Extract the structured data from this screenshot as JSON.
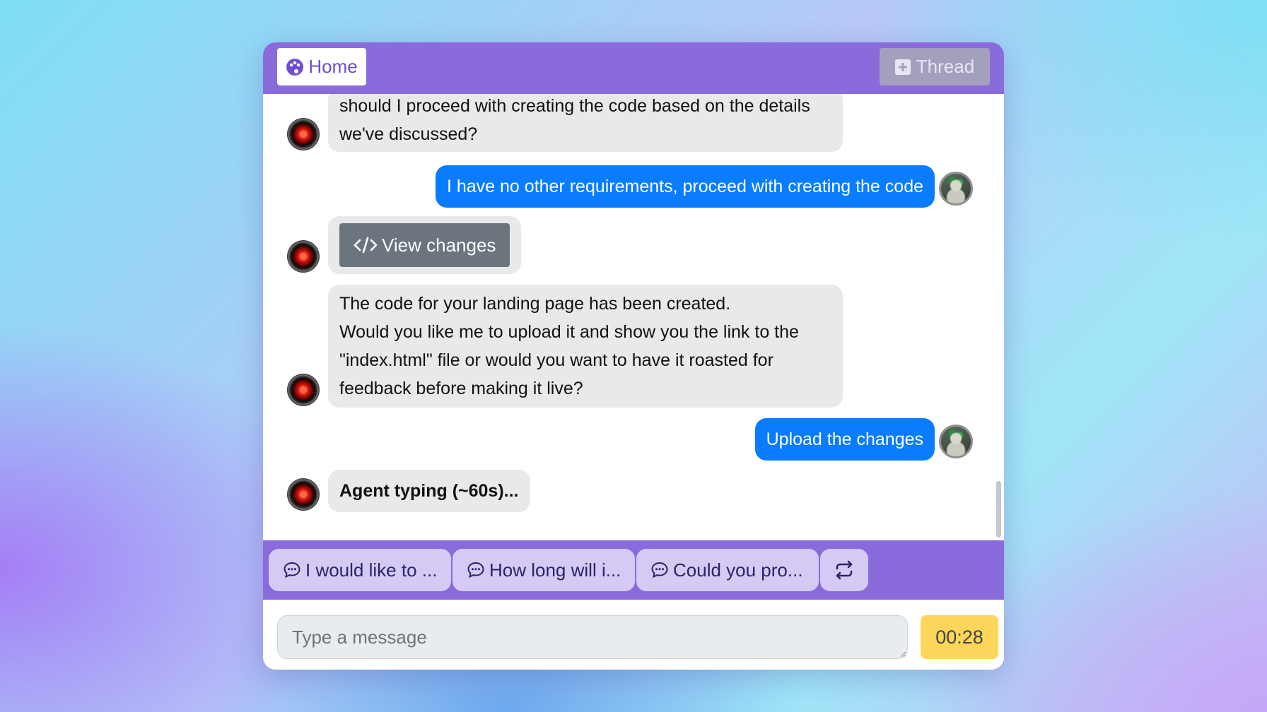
{
  "header": {
    "home_label": "Home",
    "thread_label": "Thread"
  },
  "messages": {
    "agent_1_line_1": "should I proceed with creating the code based on the details",
    "agent_1_line_2": "we've discussed?",
    "user_1": "I have no other requirements, proceed with creating the code",
    "view_changes_label": "View changes",
    "agent_2_line_1": "The code for your landing page has been created.",
    "agent_2_line_2": "Would you like me to upload it and show you the link to the",
    "agent_2_line_3": "\"index.html\" file or would you want to have it roasted for",
    "agent_2_line_4": "feedback before making it live?",
    "user_2": "Upload the changes",
    "typing_status": "Agent typing (~60s)..."
  },
  "suggestions": {
    "chip_1": "I would like to ...",
    "chip_2": "How long will i...",
    "chip_3": "Could you pro..."
  },
  "composer": {
    "placeholder": "Type a message",
    "timer": "00:28"
  },
  "colors": {
    "header_purple": "#8a6bdb",
    "user_bubble_blue": "#0a7cff",
    "agent_bubble_gray": "#e9e9eb",
    "timer_yellow": "#fcd65a"
  },
  "icons": [
    "palette-icon",
    "plus-square-icon",
    "code-icon",
    "chat-dots-icon",
    "refresh-arrows-icon"
  ]
}
